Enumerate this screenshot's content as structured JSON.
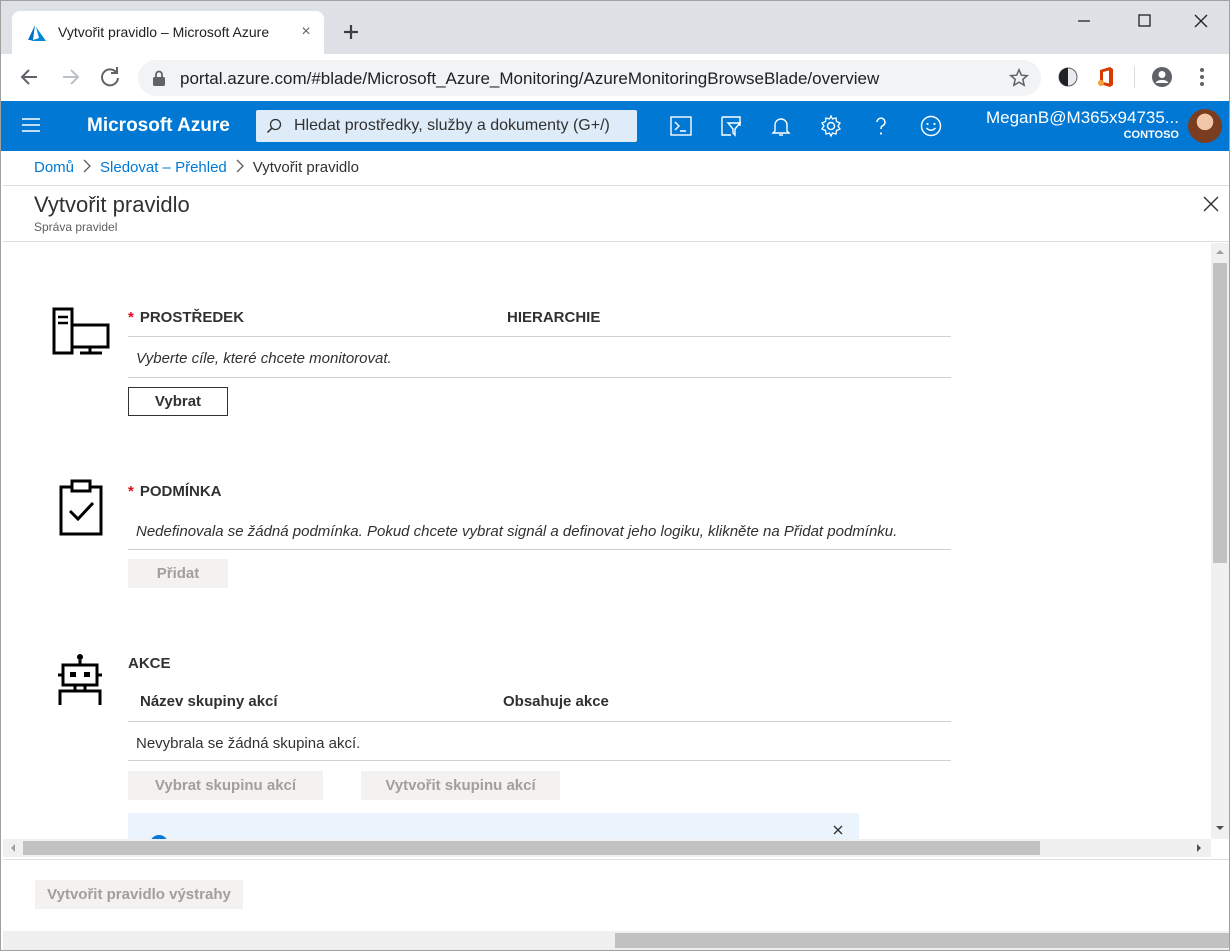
{
  "browser": {
    "tab_title": "Vytvořit pravidlo – Microsoft Azure",
    "tab_close": "×",
    "url": "portal.azure.com/#blade/Microsoft_Azure_Monitoring/AzureMonitoringBrowseBlade/overview"
  },
  "azure_header": {
    "brand": "Microsoft Azure",
    "search_placeholder": "Hledat prostředky, služby a dokumenty (G+/)",
    "user_name": "MeganB@M365x94735...",
    "user_org": "CONTOSO",
    "accent": "#0078d4"
  },
  "breadcrumb": {
    "items": [
      "Domů",
      "Sledovat – Přehled",
      "Vytvořit pravidlo"
    ]
  },
  "blade": {
    "title": "Vytvořit pravidlo",
    "subtitle": "Správa pravidel"
  },
  "resource": {
    "required_mark": "*",
    "title": "PROSTŘEDEK",
    "hierarchy_label": "HIERARCHIE",
    "note": "Vyberte cíle, které chcete monitorovat.",
    "select_button": "Vybrat"
  },
  "condition": {
    "required_mark": "*",
    "title": "PODMÍNKA",
    "note": "Nedefinovala se žádná podmínka. Pokud chcete vybrat signál a definovat jeho logiku, klikněte na Přidat podmínku.",
    "add_button": "Přidat"
  },
  "actions": {
    "title": "AKCE",
    "columns": [
      "Název skupiny akcí",
      "Obsahuje akce"
    ],
    "empty_text": "Nevybrala se žádná skupina akcí.",
    "select_button": "Vybrat skupinu akcí",
    "create_button": "Vytvořit skupinu akcí"
  },
  "footer": {
    "create_rule_button": "Vytvořit pravidlo výstrahy"
  }
}
